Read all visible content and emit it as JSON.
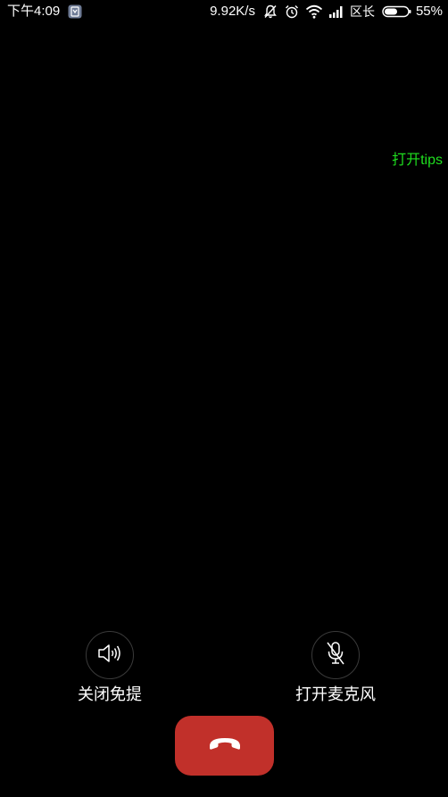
{
  "status_bar": {
    "time": "下午4:09",
    "net_speed": "9.92K/s",
    "carrier": "区长",
    "battery": "55%",
    "icons": [
      "app-notification-icon",
      "notification-off-icon",
      "alarm-icon",
      "wifi-icon",
      "signal-icon",
      "battery-icon"
    ]
  },
  "tips": {
    "label": "打开tips",
    "color": "#1fdf1f"
  },
  "controls": {
    "speaker_label": "关闭免提",
    "mic_label": "打开麦克风",
    "hangup_color": "#c1302a"
  }
}
